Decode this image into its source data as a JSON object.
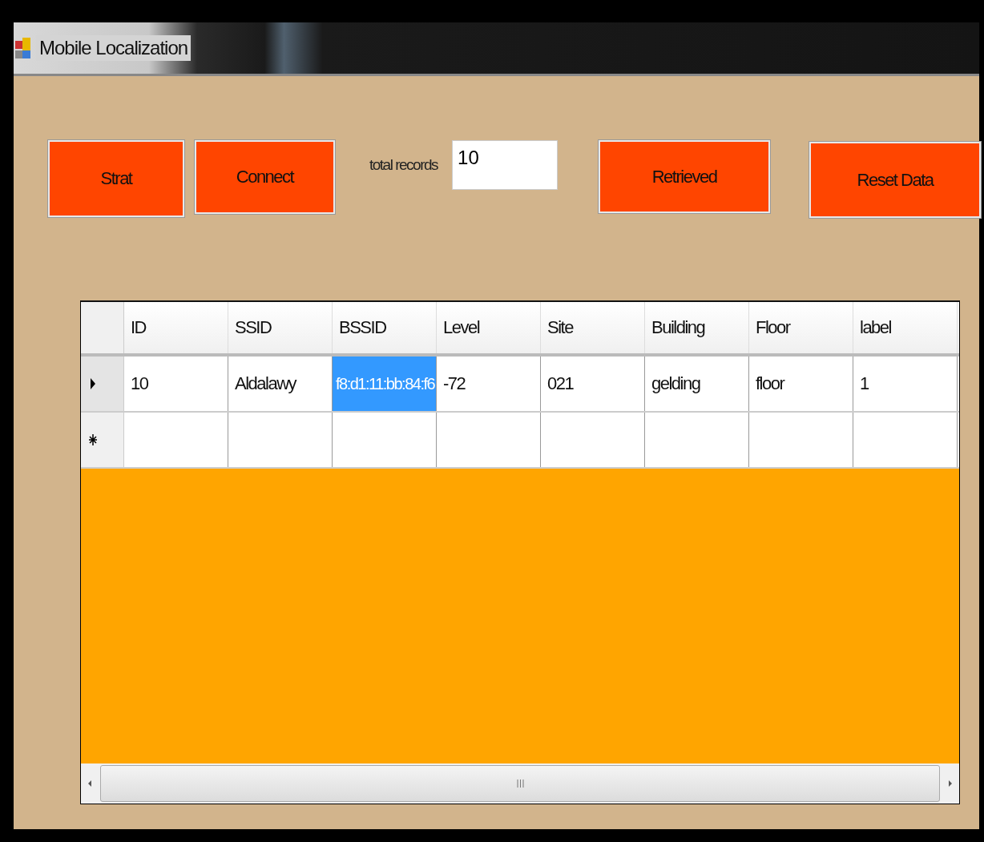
{
  "window": {
    "title": "Mobile Localization"
  },
  "toolbar": [
    {
      "kind": "button",
      "label": "Strat"
    },
    {
      "kind": "button",
      "label": "Connect"
    },
    {
      "kind": "field",
      "label": "total records",
      "value": "10"
    },
    {
      "kind": "button",
      "label": "Retrieved"
    },
    {
      "kind": "button",
      "label": "Reset Data"
    }
  ],
  "table": {
    "columns": [
      "ID",
      "SSID",
      "BSSID",
      "Level",
      "Site",
      "Building",
      "Floor",
      "label"
    ],
    "rows": [
      {
        "kind": "data",
        "current": true,
        "cells": [
          {
            "text": "10",
            "selected": false
          },
          {
            "text": "Aldalawy",
            "selected": false
          },
          {
            "text": "f8:d1:11:bb:84:f6",
            "selected": true
          },
          {
            "text": "-72",
            "selected": false
          },
          {
            "text": "021",
            "selected": false
          },
          {
            "text": "gelding",
            "selected": false
          },
          {
            "text": "floor",
            "selected": false
          },
          {
            "text": "1",
            "selected": false
          }
        ]
      },
      {
        "kind": "new",
        "current": false
      }
    ]
  }
}
